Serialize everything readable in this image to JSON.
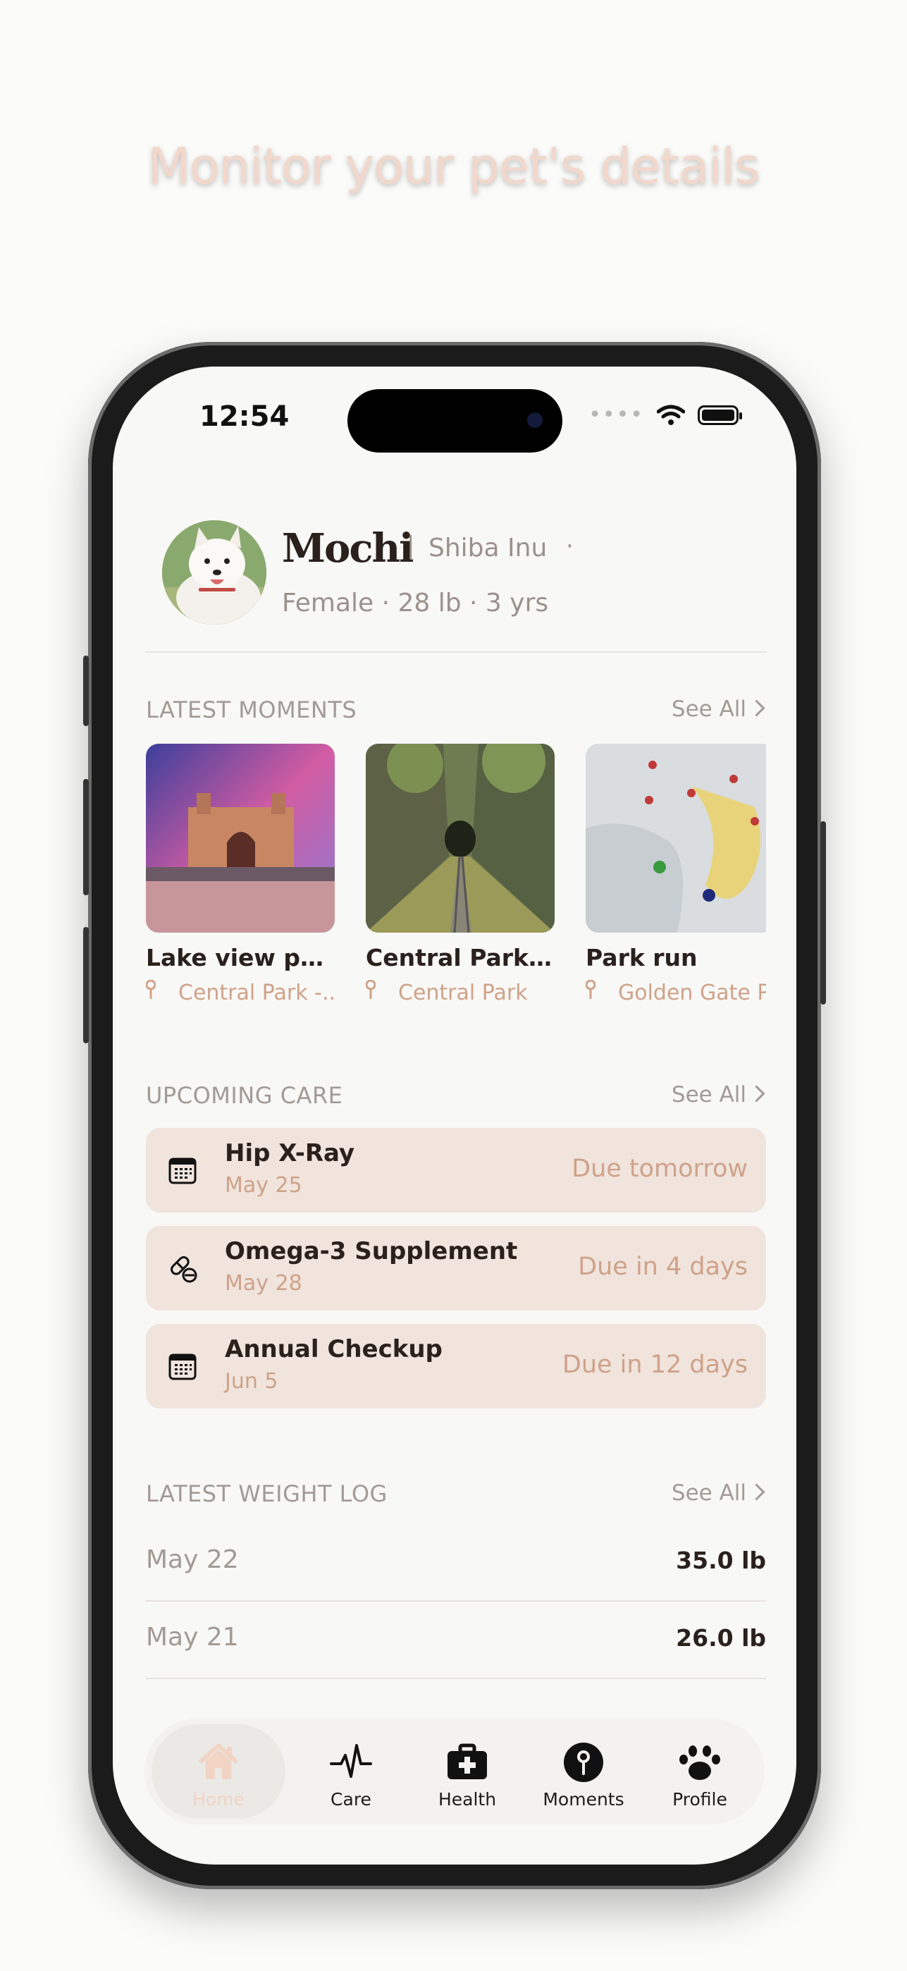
{
  "headline": "Monitor your pet's details",
  "status_bar": {
    "time": "12:54"
  },
  "pet": {
    "name": "Mochi",
    "separator": "|",
    "breed": "Shiba Inu",
    "breed_dot": "·",
    "meta": "Female · 28 lb · 3 yrs"
  },
  "moments": {
    "title": "LATEST MOMENTS",
    "see_all": "See All",
    "items": [
      {
        "title": "Lake view pause",
        "location": "Central Park -..."
      },
      {
        "title": "Central Park str...",
        "location": "Central Park"
      },
      {
        "title": "Park run",
        "location": "Golden Gate P"
      }
    ]
  },
  "care": {
    "title": "UPCOMING CARE",
    "see_all": "See All",
    "items": [
      {
        "name": "Hip X-Ray",
        "date": "May 25",
        "due": "Due tomorrow",
        "icon": "calendar-icon"
      },
      {
        "name": "Omega-3 Supplement",
        "date": "May 28",
        "due": "Due in 4 days",
        "icon": "pills-icon"
      },
      {
        "name": "Annual Checkup",
        "date": "Jun 5",
        "due": "Due in 12 days",
        "icon": "calendar-icon"
      }
    ]
  },
  "weight": {
    "title": "LATEST WEIGHT LOG",
    "see_all": "See All",
    "rows": [
      {
        "date": "May 22",
        "value": "35.0 lb"
      },
      {
        "date": "May 21",
        "value": "26.0 lb"
      }
    ]
  },
  "tabs": [
    {
      "label": "Home",
      "icon": "home-icon",
      "active": true
    },
    {
      "label": "Care",
      "icon": "heartbeat-icon"
    },
    {
      "label": "Health",
      "icon": "medkit-icon"
    },
    {
      "label": "Moments",
      "icon": "pin-icon"
    },
    {
      "label": "Profile",
      "icon": "paw-icon"
    }
  ],
  "colors": {
    "accent": "#cfa289",
    "card": "#f0e4dd",
    "text": "#2a211d",
    "muted": "#a29a95"
  }
}
